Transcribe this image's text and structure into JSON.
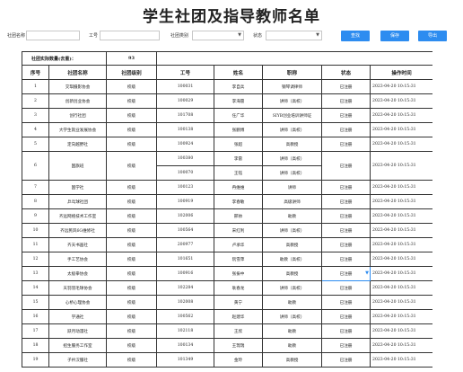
{
  "page": {
    "title": "学生社团及指导教师名单"
  },
  "filters": {
    "club_name_label": "社团名称",
    "staff_no_label": "工号",
    "category_label": "社团类别",
    "status_label": "状态",
    "club_name_value": "",
    "staff_no_value": "",
    "category_value": "",
    "status_value": "",
    "query_button": "查找",
    "save_button": "保存",
    "export_button": "导出"
  },
  "summary": {
    "label": "社团实际数量(去重)：",
    "count": "93"
  },
  "table": {
    "headers": [
      "序号",
      "社团名称",
      "社团级别",
      "工号",
      "姓名",
      "职称",
      "状态",
      "操作时间"
    ],
    "rows": [
      {
        "no": "1",
        "club": "交琪摄影协会",
        "level": "校级",
        "staff": [
          {
            "id": "100031",
            "name": "李自兵",
            "title": "钢琴调律师"
          }
        ],
        "status": "已注册",
        "time": "2023-04-20 10:15:31"
      },
      {
        "no": "2",
        "club": "创新创业协会",
        "level": "校级",
        "staff": [
          {
            "id": "100029",
            "name": "李海雷",
            "title": "讲师（高校）"
          }
        ],
        "status": "已注册",
        "time": "2023-04-20 10:15:31"
      },
      {
        "no": "3",
        "club": "创行社团",
        "level": "校级",
        "staff": [
          {
            "id": "101708",
            "name": "任广华",
            "title": "SIYB创业培训讲师证"
          }
        ],
        "status": "已注册",
        "time": "2023-04-20 10:15:31"
      },
      {
        "no": "4",
        "club": "大学生就业发展协会",
        "level": "校级",
        "staff": [
          {
            "id": "100138",
            "name": "张鹏博",
            "title": "讲师（高校）"
          }
        ],
        "status": "已注册",
        "time": "2023-04-20 10:15:31"
      },
      {
        "no": "5",
        "club": "定向越野社",
        "level": "校级",
        "staff": [
          {
            "id": "100924",
            "name": "张超",
            "title": "高教授"
          }
        ],
        "status": "已注册",
        "time": "2023-04-20 10:15:31"
      },
      {
        "no": "6",
        "club": "国旗班",
        "level": "校级",
        "staff": [
          {
            "id": "100380",
            "name": "李雷",
            "title": "讲师（高校）"
          },
          {
            "id": "100070",
            "name": "王钰",
            "title": "讲师（高校）"
          }
        ],
        "status": "已注册",
        "time": "2023-04-20 10:15:31"
      },
      {
        "no": "7",
        "club": "国学社",
        "level": "校级",
        "staff": [
          {
            "id": "100123",
            "name": "冉维维",
            "title": "讲师"
          }
        ],
        "status": "已注册",
        "time": "2023-04-20 10:15:31"
      },
      {
        "no": "8",
        "club": "乒乓球社团",
        "level": "校级",
        "staff": [
          {
            "id": "100919",
            "name": "李春敏",
            "title": "高级讲师"
          }
        ],
        "status": "已注册",
        "time": "2023-04-20 10:15:31"
      },
      {
        "no": "9",
        "club": "齐远网络技术工作室",
        "level": "校级",
        "staff": [
          {
            "id": "102006",
            "name": "邢帅",
            "title": "助教"
          }
        ],
        "status": "已注册",
        "time": "2023-04-20 10:15:31"
      },
      {
        "no": "10",
        "club": "齐远民风6G维修社",
        "level": "校级",
        "staff": [
          {
            "id": "100564",
            "name": "宋红利",
            "title": "讲师（高校）"
          }
        ],
        "status": "已注册",
        "time": "2023-04-20 10:15:31"
      },
      {
        "no": "11",
        "club": "齐天书画社",
        "level": "校级",
        "staff": [
          {
            "id": "200977",
            "name": "卢承华",
            "title": "高教授"
          }
        ],
        "status": "已注册",
        "time": "2023-04-20 10:15:31"
      },
      {
        "no": "12",
        "club": "手工艺协会",
        "level": "校级",
        "staff": [
          {
            "id": "101651",
            "name": "阮雪萍",
            "title": "助教（高校）"
          }
        ],
        "status": "已注册",
        "time": "2023-04-20 10:15:31"
      },
      {
        "no": "13",
        "club": "太极拳协会",
        "level": "校级",
        "staff": [
          {
            "id": "100916",
            "name": "张振中",
            "title": "高教授"
          }
        ],
        "status": "已注册",
        "time": "2023-04-20 10:15:31",
        "selected": true
      },
      {
        "no": "14",
        "club": "天羽羽毛球协会",
        "level": "校级",
        "staff": [
          {
            "id": "102284",
            "name": "耿春龙",
            "title": "讲师（高校）"
          }
        ],
        "status": "已注册",
        "time": "2023-04-20 10:15:31"
      },
      {
        "no": "15",
        "club": "心桥心理协会",
        "level": "校级",
        "staff": [
          {
            "id": "102008",
            "name": "黄宁",
            "title": "助教"
          }
        ],
        "status": "已注册",
        "time": "2023-04-20 10:15:31"
      },
      {
        "no": "16",
        "club": "学通社",
        "level": "校级",
        "staff": [
          {
            "id": "100562",
            "name": "赵建华",
            "title": "讲师（高校）"
          }
        ],
        "status": "已注册",
        "time": "2023-04-20 10:15:31"
      },
      {
        "no": "17",
        "club": "跃月动漫社",
        "level": "校级",
        "staff": [
          {
            "id": "102118",
            "name": "王欣",
            "title": "助教"
          }
        ],
        "status": "已注册",
        "time": "2023-04-20 10:15:31"
      },
      {
        "no": "18",
        "club": "招生服务工作室",
        "level": "校级",
        "staff": [
          {
            "id": "100134",
            "name": "王琉瑞",
            "title": "助教"
          }
        ],
        "status": "已注册",
        "time": "2023-04-20 10:15:31"
      },
      {
        "no": "19",
        "club": "子衿汉服社",
        "level": "校级",
        "staff": [
          {
            "id": "101349",
            "name": "金玲",
            "title": "高教授"
          }
        ],
        "status": "已注册",
        "time": "2023-04-20 10:15:31"
      }
    ]
  }
}
